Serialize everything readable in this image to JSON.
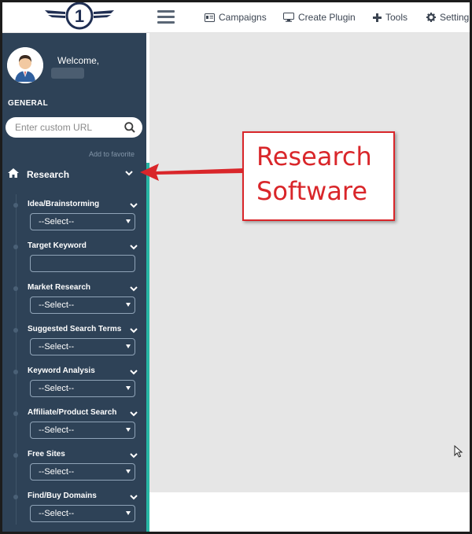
{
  "topbar": {
    "logo_text": "1",
    "nav": [
      {
        "label": "Campaigns",
        "icon": "id-card-icon"
      },
      {
        "label": "Create Plugin",
        "icon": "monitor-icon"
      },
      {
        "label": "Tools",
        "icon": "plus-icon"
      },
      {
        "label": "Setting",
        "icon": "gear-icon"
      }
    ]
  },
  "sidebar": {
    "welcome": "Welcome,",
    "section": "GENERAL",
    "search_placeholder": "Enter custom URL",
    "add_favorite": "Add to favorite",
    "menu": {
      "label": "Research",
      "items": [
        {
          "label": "Idea/Brainstorming",
          "control": "select",
          "value": "--Select--"
        },
        {
          "label": "Target Keyword",
          "control": "text",
          "value": ""
        },
        {
          "label": "Market Research",
          "control": "select",
          "value": "--Select--"
        },
        {
          "label": "Suggested Search Terms",
          "control": "select",
          "value": "--Select--"
        },
        {
          "label": "Keyword Analysis",
          "control": "select",
          "value": "--Select--"
        },
        {
          "label": "Affiliate/Product Search",
          "control": "select",
          "value": "--Select--"
        },
        {
          "label": "Free Sites",
          "control": "select",
          "value": "--Select--"
        },
        {
          "label": "Find/Buy Domains",
          "control": "select",
          "value": "--Select--"
        }
      ]
    }
  },
  "annotation": {
    "line1": "Research",
    "line2": "Software"
  },
  "colors": {
    "sidebar": "#2e4257",
    "accent": "#27b6a4",
    "annotation": "#d9262a",
    "main": "#e6e6e6"
  }
}
